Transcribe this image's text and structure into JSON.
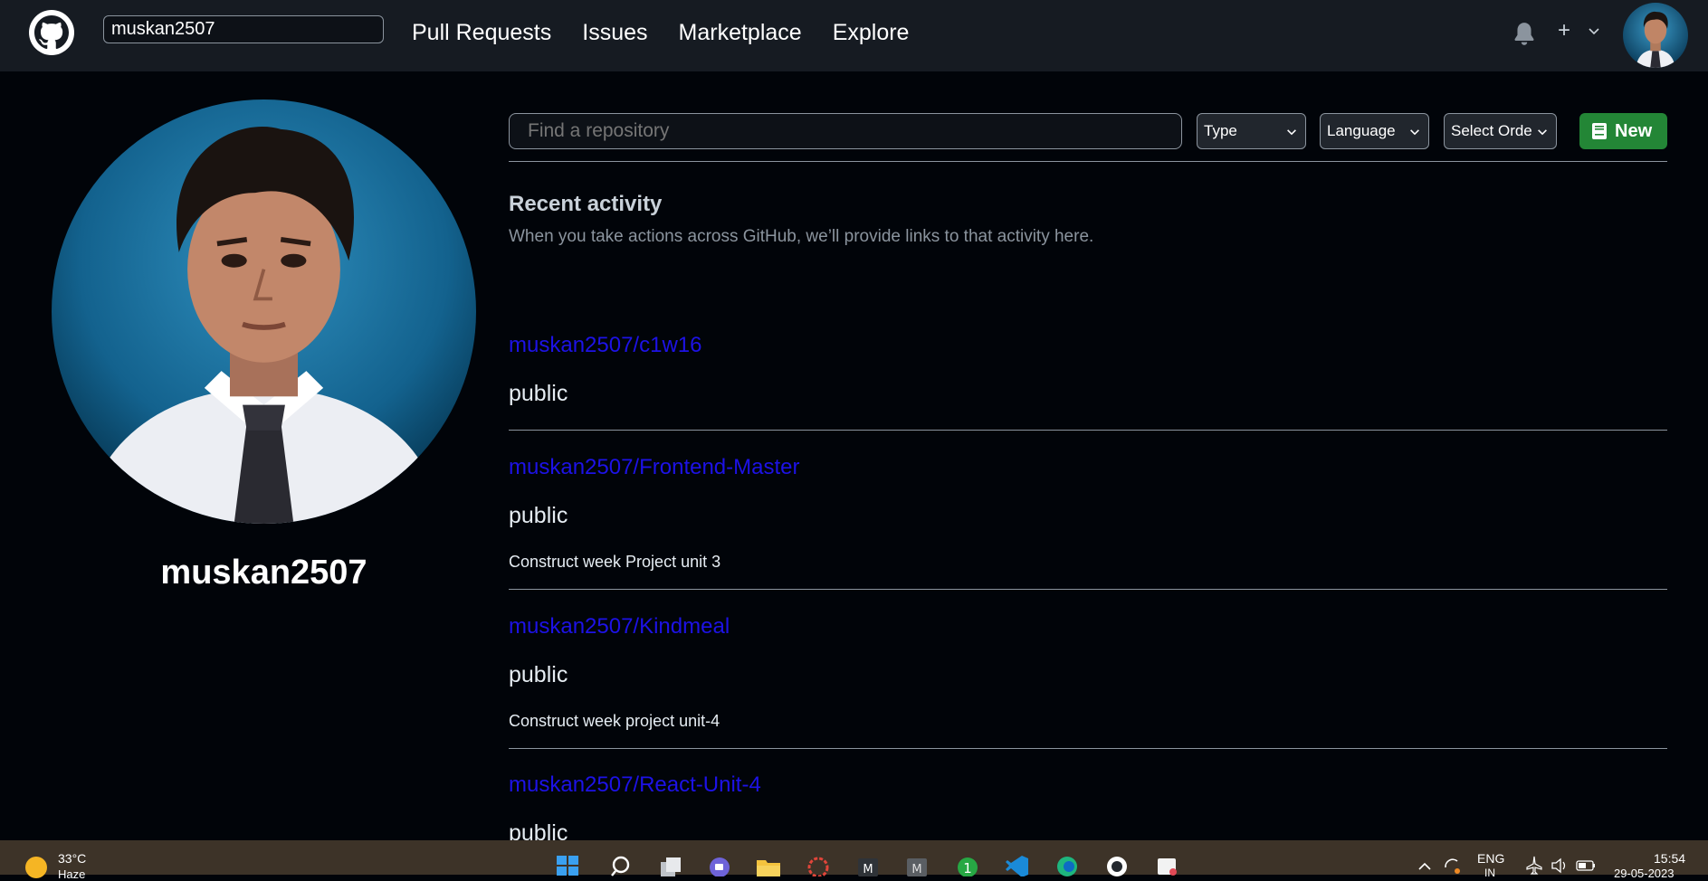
{
  "header": {
    "search_value": "muskan2507",
    "nav": [
      "Pull Requests",
      "Issues",
      "Marketplace",
      "Explore"
    ],
    "plus_label": "+"
  },
  "profile": {
    "username": "muskan2507"
  },
  "filters": {
    "find_placeholder": "Find a repository",
    "type_label": "Type",
    "language_label": "Language",
    "order_label": "Select Orde",
    "new_label": "New"
  },
  "recent_activity": {
    "title": "Recent activity",
    "description": "When you take actions across GitHub, we’ll provide links to that activity here."
  },
  "repos": [
    {
      "name": "muskan2507/c1w16",
      "visibility": "public",
      "description": ""
    },
    {
      "name": "muskan2507/Frontend-Master",
      "visibility": "public",
      "description": "Construct week Project unit 3"
    },
    {
      "name": "muskan2507/Kindmeal",
      "visibility": "public",
      "description": "Construct week project unit-4"
    },
    {
      "name": "muskan2507/React-Unit-4",
      "visibility": "public",
      "description": ""
    }
  ],
  "taskbar": {
    "temperature": "33°C",
    "weather_sub": "Haze",
    "language_line1": "ENG",
    "language_line2": "IN",
    "time": "15:54",
    "date": "29-05-2023"
  },
  "colors": {
    "link": "#1d12e6",
    "new_button": "#238636",
    "header_bg": "#161b22",
    "page_bg": "#010409"
  }
}
